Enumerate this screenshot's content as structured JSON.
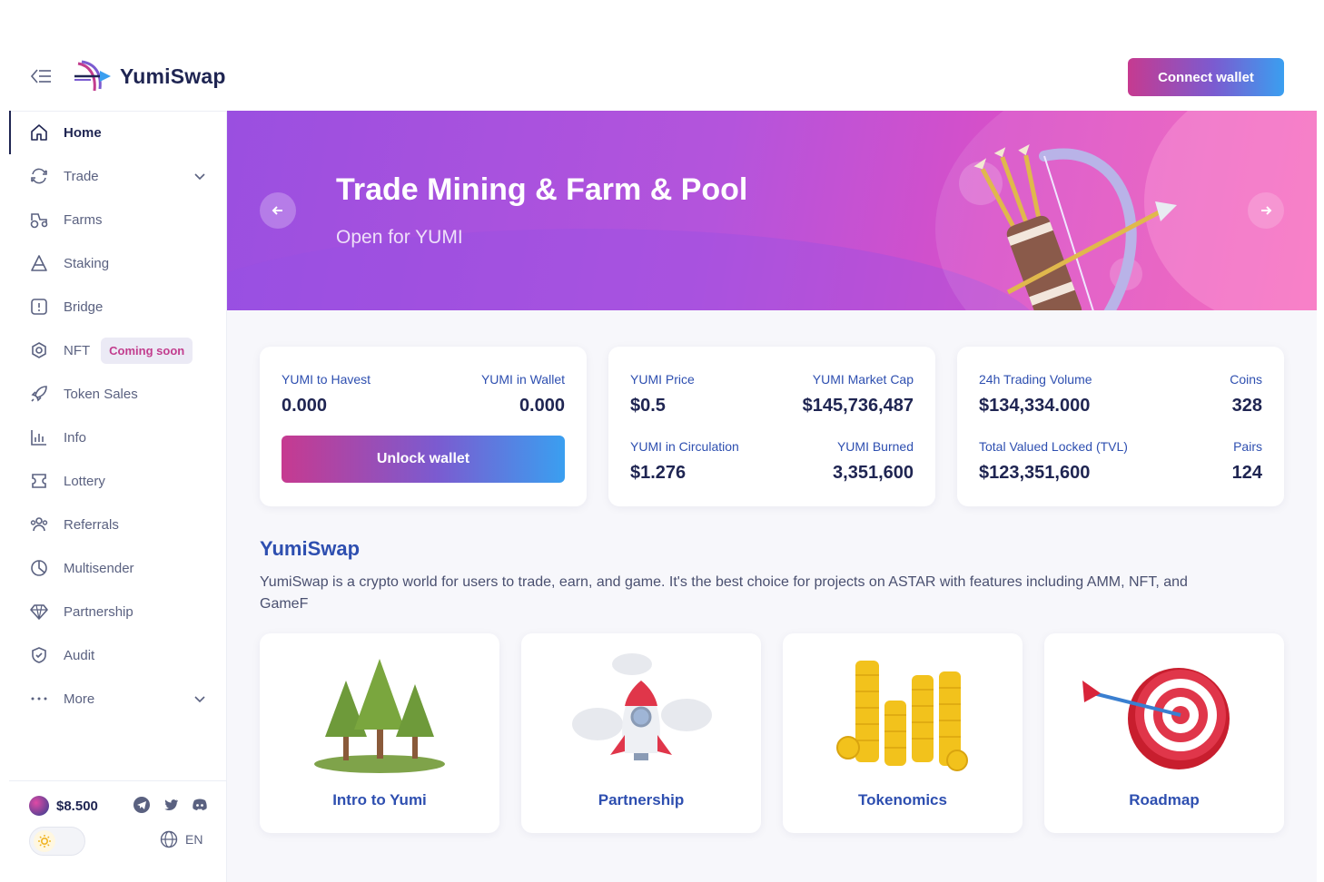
{
  "brand": {
    "name": "YumiSwap"
  },
  "header": {
    "connect_label": "Connect wallet"
  },
  "sidebar": {
    "items": [
      {
        "label": "Home",
        "icon": "home-icon"
      },
      {
        "label": "Trade",
        "icon": "trade-icon"
      },
      {
        "label": "Farms",
        "icon": "farms-icon"
      },
      {
        "label": "Staking",
        "icon": "staking-icon"
      },
      {
        "label": "Bridge",
        "icon": "bridge-icon"
      },
      {
        "label": "NFT",
        "icon": "nft-icon",
        "badge": "Coming soon"
      },
      {
        "label": "Token Sales",
        "icon": "rocket-icon"
      },
      {
        "label": "Info",
        "icon": "chart-icon"
      },
      {
        "label": "Lottery",
        "icon": "ticket-icon"
      },
      {
        "label": "Referrals",
        "icon": "users-icon"
      },
      {
        "label": "Multisender",
        "icon": "pie-icon"
      },
      {
        "label": "Partnership",
        "icon": "diamond-icon"
      },
      {
        "label": "Audit",
        "icon": "shield-icon"
      },
      {
        "label": "More",
        "icon": "more-dots-icon"
      }
    ],
    "footer": {
      "price": "$8.500",
      "language": "EN"
    }
  },
  "banner": {
    "title": "Trade Mining & Farm & Pool",
    "subtitle": "Open for YUMI"
  },
  "stats": {
    "card1": {
      "harvest_label": "YUMI to Havest",
      "harvest_value": "0.000",
      "wallet_label": "YUMI in Wallet",
      "wallet_value": "0.000",
      "unlock_label": "Unlock wallet"
    },
    "card2": {
      "price_label": "YUMI Price",
      "price_value": "$0.5",
      "mcap_label": "YUMI Market Cap",
      "mcap_value": "$145,736,487",
      "circ_label": "YUMI in Circulation",
      "circ_value": "$1.276",
      "burned_label": "YUMI Burned",
      "burned_value": "3,351,600"
    },
    "card3": {
      "volume_label": "24h Trading Volume",
      "volume_value": "$134,334.000",
      "coins_label": "Coins",
      "coins_value": "328",
      "tvl_label": "Total Valued Locked (TVL)",
      "tvl_value": "$123,351,600",
      "pairs_label": "Pairs",
      "pairs_value": "124"
    }
  },
  "about": {
    "title": "YumiSwap",
    "text": "YumiSwap is a crypto world for users to trade, earn, and game. It's the best choice for projects on ASTAR with features including AMM, NFT, and GameF"
  },
  "features": [
    {
      "label": "Intro to Yumi"
    },
    {
      "label": "Partnership"
    },
    {
      "label": "Tokenomics"
    },
    {
      "label": "Roadmap"
    }
  ],
  "colors": {
    "accent_text": "#2e4fb0",
    "dark_text": "#1f2552",
    "gradient_start": "#c63a90",
    "gradient_end": "#3a9ff0",
    "banner_start": "#9a4fe0",
    "banner_end": "#f45bb5"
  }
}
